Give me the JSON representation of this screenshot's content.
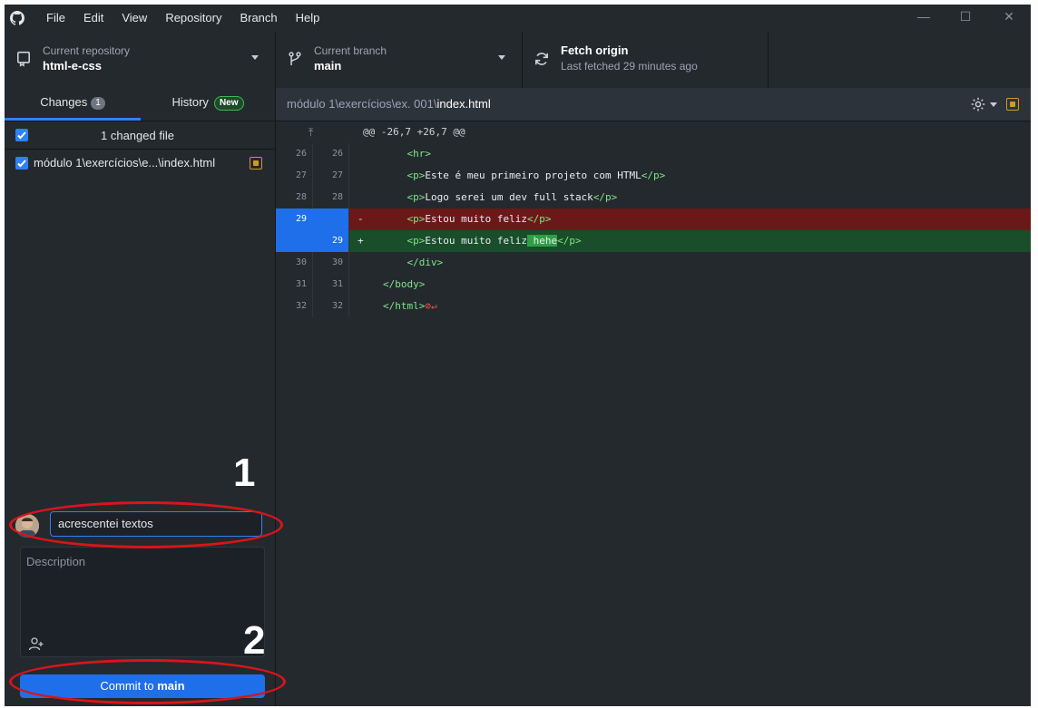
{
  "menu": [
    "File",
    "Edit",
    "View",
    "Repository",
    "Branch",
    "Help"
  ],
  "window_controls": {
    "minimize": "—",
    "maximize": "☐",
    "close": "✕"
  },
  "toolbar": {
    "repo_label": "Current repository",
    "repo_value": "html-e-css",
    "branch_label": "Current branch",
    "branch_value": "main",
    "fetch_label": "Fetch origin",
    "fetch_sub": "Last fetched 29 minutes ago"
  },
  "tabs": {
    "changes": "Changes",
    "changes_count": "1",
    "history": "History",
    "history_badge": "New"
  },
  "changes": {
    "header": "1 changed file",
    "files": [
      {
        "path": "módulo 1\\exercícios\\e...\\index.html"
      }
    ]
  },
  "commit": {
    "summary": "acrescentei textos",
    "description_placeholder": "Description",
    "button_prefix": "Commit to ",
    "button_branch": "main"
  },
  "annotations": [
    "1",
    "2"
  ],
  "diff": {
    "path_prefix": "módulo 1\\exercícios\\ex. 001\\",
    "path_file": "index.html",
    "hunk": "@@ -26,7 +26,7 @@",
    "lines": [
      {
        "old": "26",
        "new": "26",
        "sign": " ",
        "type": "ctx",
        "indent": "    ",
        "open": "<hr>",
        "text": "",
        "close": ""
      },
      {
        "old": "27",
        "new": "27",
        "sign": " ",
        "type": "ctx",
        "indent": "    ",
        "open": "<p>",
        "text": "Este é meu primeiro projeto com HTML",
        "close": "</p>"
      },
      {
        "old": "28",
        "new": "28",
        "sign": " ",
        "type": "ctx",
        "indent": "    ",
        "open": "<p>",
        "text": "Logo serei um dev full stack",
        "close": "</p>"
      },
      {
        "old": "29",
        "new": "",
        "sign": "-",
        "type": "del",
        "indent": "    ",
        "open": "<p>",
        "text": "Estou muito feliz",
        "close": "</p>"
      },
      {
        "old": "",
        "new": "29",
        "sign": "+",
        "type": "add",
        "indent": "    ",
        "open": "<p>",
        "text": "Estou muito feliz",
        "highlight": " hehe",
        "close": "</p>"
      },
      {
        "old": "30",
        "new": "30",
        "sign": " ",
        "type": "ctx",
        "indent": "    ",
        "open": "</div>",
        "text": "",
        "close": ""
      },
      {
        "old": "31",
        "new": "31",
        "sign": " ",
        "type": "ctx",
        "indent": "",
        "open": "</body>",
        "text": "",
        "close": ""
      },
      {
        "old": "32",
        "new": "32",
        "sign": " ",
        "type": "ctx",
        "indent": "",
        "open": "</html>",
        "text": "",
        "close": "",
        "no_newline": "⊘↵"
      }
    ]
  },
  "colors": {
    "accent": "#1f6feb",
    "deleted": "#9b1c1c",
    "added": "#166534",
    "annotation": "#d8151b"
  }
}
